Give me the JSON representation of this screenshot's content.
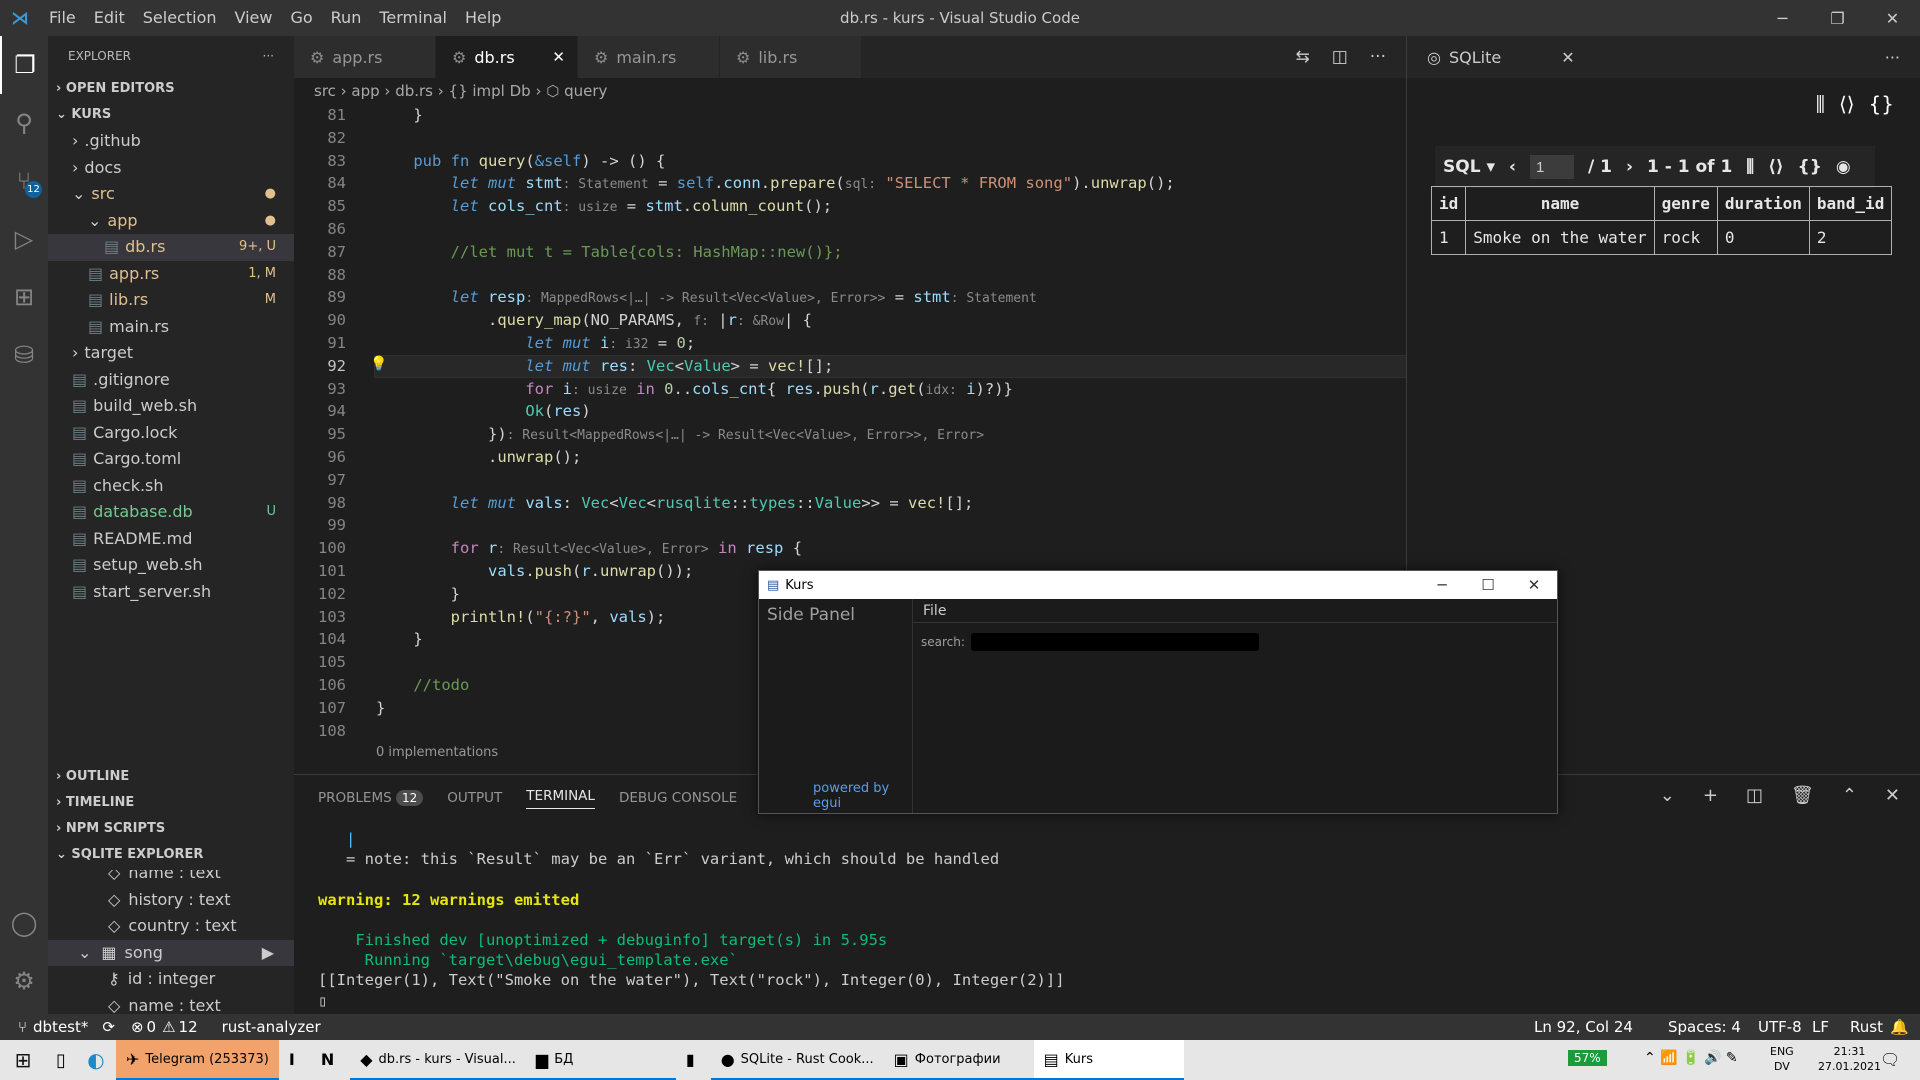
{
  "window": {
    "title": "db.rs - kurs - Visual Studio Code"
  },
  "menu": [
    "File",
    "Edit",
    "Selection",
    "View",
    "Go",
    "Run",
    "Terminal",
    "Help"
  ],
  "activity": {
    "scm_badge": "12"
  },
  "explorer": {
    "header": "EXPLORER",
    "open_editors": "OPEN EDITORS",
    "root": "KURS",
    "tree": [
      {
        "label": ".github",
        "indent": 1,
        "kind": "folder-closed",
        "cls": "",
        "dec": ""
      },
      {
        "label": "docs",
        "indent": 1,
        "kind": "folder-closed",
        "cls": "",
        "dec": ""
      },
      {
        "label": "src",
        "indent": 1,
        "kind": "folder-open",
        "cls": "mod",
        "dec": "●"
      },
      {
        "label": "app",
        "indent": 2,
        "kind": "folder-open",
        "cls": "mod",
        "dec": "●"
      },
      {
        "label": "db.rs",
        "indent": 3,
        "kind": "file",
        "cls": "mod",
        "dec": "9+, U",
        "sel": true
      },
      {
        "label": "app.rs",
        "indent": 2,
        "kind": "file",
        "cls": "mod",
        "dec": "1, M"
      },
      {
        "label": "lib.rs",
        "indent": 2,
        "kind": "file",
        "cls": "mod",
        "dec": "M"
      },
      {
        "label": "main.rs",
        "indent": 2,
        "kind": "file",
        "cls": "",
        "dec": ""
      },
      {
        "label": "target",
        "indent": 1,
        "kind": "folder-closed",
        "cls": "",
        "dec": ""
      },
      {
        "label": ".gitignore",
        "indent": 1,
        "kind": "file",
        "cls": "",
        "dec": ""
      },
      {
        "label": "build_web.sh",
        "indent": 1,
        "kind": "file",
        "cls": "",
        "dec": ""
      },
      {
        "label": "Cargo.lock",
        "indent": 1,
        "kind": "file",
        "cls": "",
        "dec": ""
      },
      {
        "label": "Cargo.toml",
        "indent": 1,
        "kind": "file",
        "cls": "",
        "dec": ""
      },
      {
        "label": "check.sh",
        "indent": 1,
        "kind": "file",
        "cls": "",
        "dec": ""
      },
      {
        "label": "database.db",
        "indent": 1,
        "kind": "file",
        "cls": "unt",
        "dec": "U"
      },
      {
        "label": "README.md",
        "indent": 1,
        "kind": "file",
        "cls": "",
        "dec": ""
      },
      {
        "label": "setup_web.sh",
        "indent": 1,
        "kind": "file",
        "cls": "",
        "dec": ""
      },
      {
        "label": "start_server.sh",
        "indent": 1,
        "kind": "file",
        "cls": "",
        "dec": ""
      }
    ],
    "sections": [
      "OUTLINE",
      "TIMELINE",
      "NPM SCRIPTS",
      "SQLITE EXPLORER"
    ],
    "sqlite_items": [
      {
        "label": "name : text",
        "sel": false,
        "icon": "◇"
      },
      {
        "label": "history : text",
        "sel": false,
        "icon": "◇"
      },
      {
        "label": "country : text",
        "sel": false,
        "icon": "◇"
      },
      {
        "label": "song",
        "sel": true,
        "icon": "▦"
      },
      {
        "label": "id : integer",
        "sel": false,
        "icon": "⚷"
      },
      {
        "label": "name : text",
        "sel": false,
        "icon": "◇"
      }
    ]
  },
  "tabs": [
    {
      "label": "app.rs",
      "active": false
    },
    {
      "label": "db.rs",
      "active": true
    },
    {
      "label": "main.rs",
      "active": false
    },
    {
      "label": "lib.rs",
      "active": false
    }
  ],
  "breadcrumbs": "src › app › db.rs › {} impl Db › ⬡ query",
  "editor": {
    "current_line": 92,
    "line_numbers": [
      81,
      82,
      83,
      84,
      85,
      86,
      87,
      88,
      89,
      90,
      91,
      92,
      93,
      94,
      95,
      96,
      97,
      98,
      99,
      100,
      101,
      102,
      103,
      104,
      105,
      106,
      107,
      108
    ],
    "codelens": "0 implementations"
  },
  "sqlite_panel": {
    "title": "SQLite",
    "mode": "SQL ▾",
    "page_input": "1",
    "page_total": "/ 1",
    "range": "1 - 1 of 1",
    "columns": [
      "id",
      "name",
      "genre",
      "duration",
      "band_id"
    ],
    "rows": [
      [
        "1",
        "Smoke on the water",
        "rock",
        "0",
        "2"
      ]
    ]
  },
  "bottom_panel": {
    "tabs": [
      "PROBLEMS",
      "OUTPUT",
      "TERMINAL",
      "DEBUG CONSOLE"
    ],
    "problems_badge": "12",
    "terminal_select": "o",
    "lines": [
      "   |",
      "   = note: this `Result` may be an `Err` variant, which should be handled",
      "",
      "warning: 12 warnings emitted",
      "",
      "    Finished dev [unoptimized + debuginfo] target(s) in 5.95s",
      "     Running `target\\debug\\egui_template.exe`",
      "[[Integer(1), Text(\"Smoke on the water\"), Text(\"rock\"), Integer(0), Integer(2)]]",
      "▯"
    ]
  },
  "kurs_window": {
    "title": "Kurs",
    "side_panel": "Side Panel",
    "powered": "powered by egui",
    "menu_file": "File",
    "search_label": "search:"
  },
  "statusbar": {
    "branch": "dbtest*",
    "errors": "0",
    "warnings": "12",
    "lsp": "rust-analyzer",
    "position": "Ln 92, Col 24",
    "spaces": "Spaces: 4",
    "encoding": "UTF-8",
    "eol": "LF",
    "language": "Rust"
  },
  "taskbar": {
    "items": [
      {
        "label": "Telegram (253373)",
        "icon": "✈",
        "running": true,
        "bg": "#f2a36c"
      },
      {
        "label": "",
        "icon": "I",
        "running": false,
        "bg": ""
      },
      {
        "label": "",
        "icon": "N",
        "running": false,
        "bg": ""
      },
      {
        "label": "db.rs - kurs - Visual...",
        "icon": "◆",
        "running": true,
        "bg": ""
      },
      {
        "label": "БД",
        "icon": "▆",
        "running": true,
        "bg": ""
      },
      {
        "label": "",
        "icon": "▮",
        "running": false,
        "bg": ""
      },
      {
        "label": "SQLite - Rust Cook...",
        "icon": "●",
        "running": true,
        "bg": ""
      },
      {
        "label": "Фотографии",
        "icon": "▣",
        "running": true,
        "bg": ""
      },
      {
        "label": "Kurs",
        "icon": "▤",
        "running": true,
        "bg": "#ffffff"
      }
    ],
    "battery": "57%",
    "lang": "ENG",
    "lang2": "DV",
    "time": "21:31",
    "date": "27.01.2021"
  }
}
